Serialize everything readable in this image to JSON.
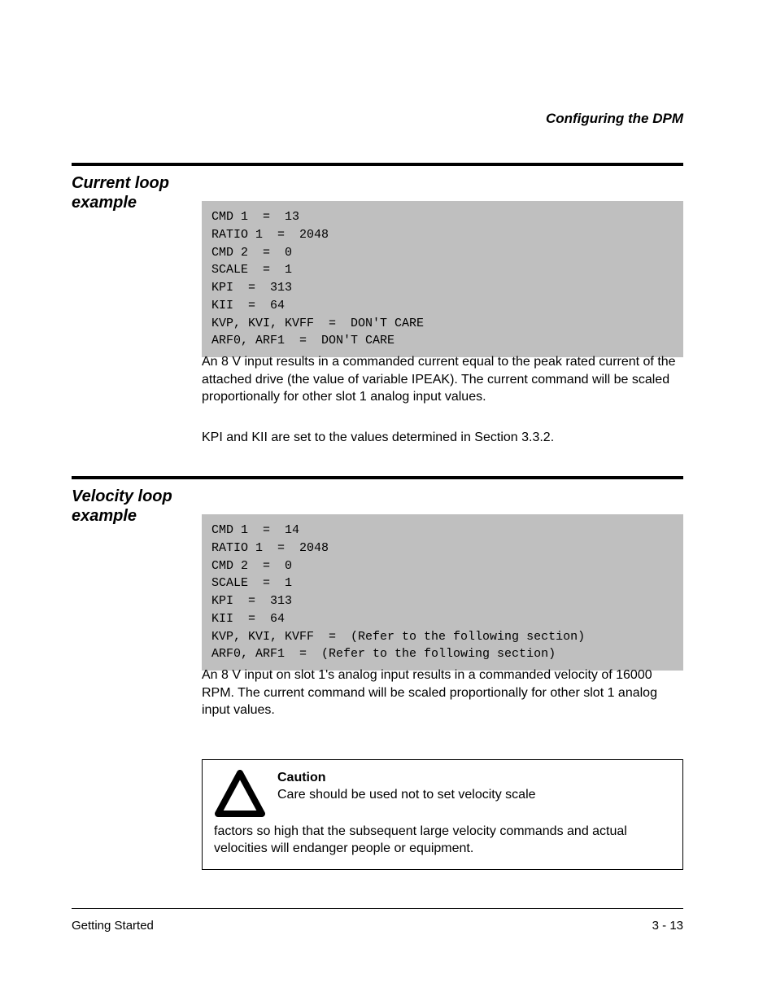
{
  "breadcrumb": "Configuring the DPM",
  "sections": [
    {
      "title": "Current loop example",
      "code": "CMD 1  =  13\nRATIO 1  =  2048\nCMD 2  =  0\nSCALE  =  1\nKPI  =  313\nKII  =  64\nKVP, KVI, KVFF  =  DON'T CARE\nARF0, ARF1  =  DON'T CARE",
      "paragraphs": [
        "An 8 V input results in a commanded current equal to the peak rated current of the attached drive (the value of variable IPEAK). The current command will be scaled proportionally for other slot 1 analog input values.",
        "KPI and KII are set to the values determined in Section 3.3.2."
      ]
    },
    {
      "title": "Velocity loop example",
      "code": "CMD 1  =  14\nRATIO 1  =  2048\nCMD 2  =  0\nSCALE  =  1\nKPI  =  313\nKII  =  64\nKVP, KVI, KVFF  =  (Refer to the following section)\nARF0, ARF1  =  (Refer to the following section)",
      "para_before_caution": "An 8 V input on slot 1's analog input results in a commanded velocity of 16000 RPM. The current command will be scaled proportionally for other slot 1 analog input values.",
      "caution": {
        "label": "Caution",
        "first_line": "Care should be used not to set velocity scale",
        "continuation": "factors so high that the subsequent large velocity commands and actual velocities will endanger people or equipment."
      }
    }
  ],
  "footer": {
    "left": "Getting Started",
    "right": "3 - 13"
  }
}
